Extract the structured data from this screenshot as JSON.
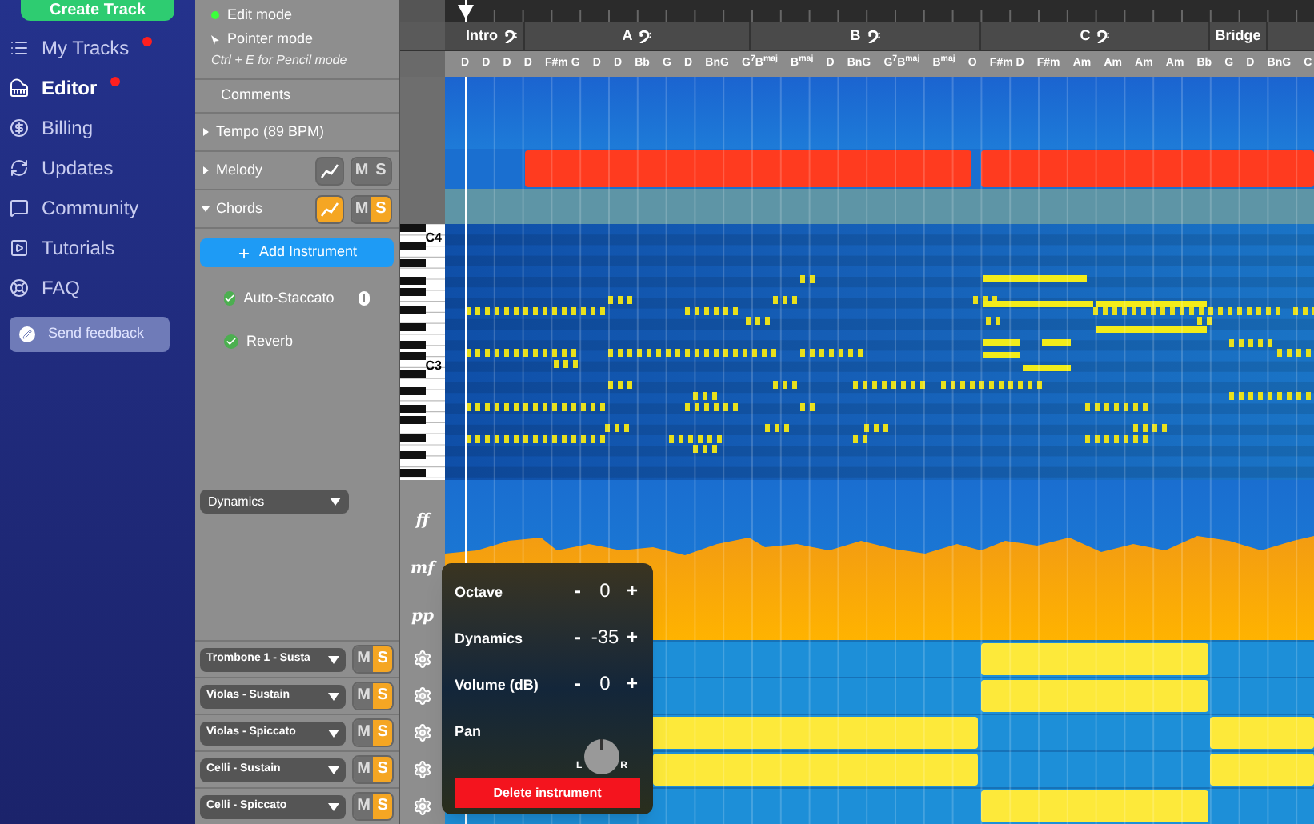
{
  "sidebar": {
    "create_button": "Create Track",
    "items": [
      {
        "label": "My Tracks",
        "selected": false,
        "badge": true
      },
      {
        "label": "Editor",
        "selected": true,
        "badge": true
      },
      {
        "label": "Billing",
        "selected": false,
        "badge": false
      },
      {
        "label": "Updates",
        "selected": false,
        "badge": false
      },
      {
        "label": "Community",
        "selected": false,
        "badge": false
      },
      {
        "label": "Tutorials",
        "selected": false,
        "badge": false
      },
      {
        "label": "FAQ",
        "selected": false,
        "badge": false
      }
    ],
    "feedback_button": "Send feedback"
  },
  "panel": {
    "modes": [
      {
        "label": "Edit mode",
        "kind": "dot"
      },
      {
        "label": "Pointer mode",
        "kind": "pointer"
      }
    ],
    "hint": "Ctrl + E for Pencil mode",
    "comments": "Comments",
    "tracks": [
      {
        "label": "Tempo (89 BPM)",
        "expanded": false,
        "kind": "plain"
      },
      {
        "label": "Melody",
        "expanded": false,
        "kind": "lane",
        "automation": false,
        "mute": {
          "label": "M",
          "on": false
        },
        "solo": {
          "label": "S",
          "on": false
        }
      },
      {
        "label": "Chords",
        "expanded": true,
        "kind": "lane",
        "automation": true,
        "mute": {
          "label": "M",
          "on": false
        },
        "solo": {
          "label": "S",
          "on": true
        }
      }
    ],
    "add_instrument": "Add Instrument",
    "effects": [
      {
        "label": "Auto-Staccato",
        "checked": true,
        "info": true
      },
      {
        "label": "Reverb",
        "checked": true
      }
    ],
    "automation_select": "Dynamics",
    "instruments": [
      {
        "name": "Trombone 1 - Susta",
        "mute": {
          "label": "M",
          "on": false
        },
        "solo": {
          "label": "S",
          "on": true
        }
      },
      {
        "name": "Violas - Sustain",
        "mute": {
          "label": "M",
          "on": false
        },
        "solo": {
          "label": "S",
          "on": true
        }
      },
      {
        "name": "Violas - Spiccato",
        "mute": {
          "label": "M",
          "on": false
        },
        "solo": {
          "label": "S",
          "on": true
        }
      },
      {
        "name": "Celli - Sustain",
        "mute": {
          "label": "M",
          "on": false
        },
        "solo": {
          "label": "S",
          "on": true
        }
      },
      {
        "name": "Celli - Spiccato",
        "mute": {
          "label": "M",
          "on": false
        },
        "solo": {
          "label": "S",
          "on": true
        }
      }
    ]
  },
  "timeline": {
    "sections": [
      {
        "label": "Intro",
        "clef": true
      },
      {
        "label": "A",
        "clef": true
      },
      {
        "label": "B",
        "clef": true
      },
      {
        "label": "C",
        "clef": true
      },
      {
        "label": "Bridge",
        "clef": false
      }
    ],
    "chords": [
      "D",
      "D",
      "D",
      "D",
      "F#m G",
      "D",
      "D",
      "Bb",
      "G",
      "D",
      "BnG",
      "G$^{7}$B$^{maj}$",
      "B$^{maj}$",
      "D",
      "BnG",
      "G$^{7}$B$^{maj}$",
      "B$^{maj}$",
      "O",
      "F#m D",
      "F#m",
      "Am",
      "Am",
      "Am",
      "Am",
      "Bb",
      "G",
      "D",
      "BnG",
      "C"
    ],
    "key_labels": [
      "C4",
      "C3"
    ],
    "dynamics_scale": [
      "ff",
      "mf",
      "pp"
    ]
  },
  "popup": {
    "rows": [
      {
        "label": "Octave",
        "minus": "-",
        "value": "0",
        "plus": "+"
      },
      {
        "label": "Dynamics",
        "minus": "-",
        "value": "-35",
        "plus": "+"
      },
      {
        "label": "Volume (dB)",
        "minus": "-",
        "value": "0",
        "plus": "+"
      }
    ],
    "pan": {
      "label": "Pan",
      "left": "L",
      "right": "R",
      "level": 0.5
    },
    "delete_button": "Delete instrument"
  }
}
